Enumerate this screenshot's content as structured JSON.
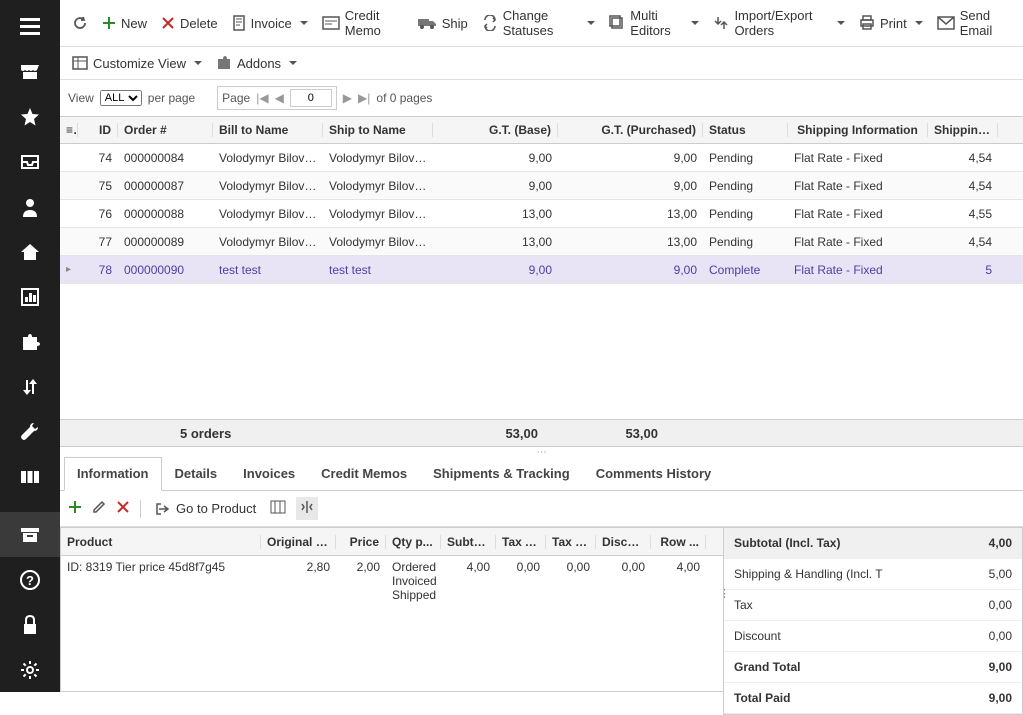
{
  "toolbar": {
    "new": "New",
    "delete": "Delete",
    "invoice": "Invoice",
    "credit_memo": "Credit Memo",
    "ship": "Ship",
    "change_statuses": "Change Statuses",
    "multi_editors": "Multi Editors",
    "import_export": "Import/Export Orders",
    "print": "Print",
    "send_email": "Send Email",
    "customize_view": "Customize View",
    "addons": "Addons"
  },
  "view": {
    "label": "View",
    "per_page": "per page",
    "page_label": "Page",
    "page_value": "0",
    "of_pages": "of 0 pages",
    "select_value": "ALL"
  },
  "grid": {
    "headers": {
      "id": "ID",
      "order": "Order #",
      "bill": "Bill to Name",
      "ship": "Ship to Name",
      "gtb": "G.T. (Base)",
      "gtp": "G.T. (Purchased)",
      "status": "Status",
      "shipinfo": "Shipping Information",
      "shipcost": "Shipping ..."
    },
    "rows": [
      {
        "id": "74",
        "order": "000000084",
        "bill": "Volodymyr Bilovus",
        "ship": "Volodymyr Bilovus",
        "gtb": "9,00",
        "gtp": "9,00",
        "status": "Pending",
        "shipinfo": "Flat Rate - Fixed",
        "shipcost": "4,54"
      },
      {
        "id": "75",
        "order": "000000087",
        "bill": "Volodymyr Bilovus",
        "ship": "Volodymyr Bilovus",
        "gtb": "9,00",
        "gtp": "9,00",
        "status": "Pending",
        "shipinfo": "Flat Rate - Fixed",
        "shipcost": "4,54"
      },
      {
        "id": "76",
        "order": "000000088",
        "bill": "Volodymyr Bilovus",
        "ship": "Volodymyr Bilovus",
        "gtb": "13,00",
        "gtp": "13,00",
        "status": "Pending",
        "shipinfo": "Flat Rate - Fixed",
        "shipcost": "4,55"
      },
      {
        "id": "77",
        "order": "000000089",
        "bill": "Volodymyr Bilovus",
        "ship": "Volodymyr Bilovus",
        "gtb": "13,00",
        "gtp": "13,00",
        "status": "Pending",
        "shipinfo": "Flat Rate - Fixed",
        "shipcost": "4,54"
      },
      {
        "id": "78",
        "order": "000000090",
        "bill": "test test",
        "ship": "test test",
        "gtb": "9,00",
        "gtp": "9,00",
        "status": "Complete",
        "shipinfo": "Flat Rate - Fixed",
        "shipcost": "5"
      }
    ],
    "footer": {
      "count": "5 orders",
      "gtb": "53,00",
      "gtp": "53,00"
    }
  },
  "tabs": {
    "information": "Information",
    "details": "Details",
    "invoices": "Invoices",
    "credit_memos": "Credit Memos",
    "shipments": "Shipments & Tracking",
    "comments": "Comments History"
  },
  "subtoolbar": {
    "goto": "Go to Product"
  },
  "lines": {
    "headers": {
      "product": "Product",
      "op": "Original Pr...",
      "price": "Price",
      "qty": "Qty p...",
      "sub": "Subto...",
      "ta": "Tax A...",
      "tp": "Tax P...",
      "disc": "Disco...",
      "row": "Row ..."
    },
    "row0": {
      "product": "ID: 8319 Tier price 45d8f7g45",
      "op": "2,80",
      "price": "2,00",
      "qty1": "Ordered",
      "qty2": "Invoiced",
      "qty3": "Shipped",
      "sub": "4,00",
      "ta": "0,00",
      "tp": "0,00",
      "disc": "0,00",
      "row": "4,00"
    }
  },
  "totals": {
    "subtotal_label": "Subtotal  (Incl. Tax)",
    "subtotal": "4,00",
    "shipping_label": "Shipping & Handling (Incl. T",
    "shipping": "5,00",
    "tax_label": "Tax",
    "tax": "0,00",
    "discount_label": "Discount",
    "discount": "0,00",
    "grand_label": "Grand Total",
    "grand": "9,00",
    "paid_label": "Total Paid",
    "paid": "9,00"
  }
}
